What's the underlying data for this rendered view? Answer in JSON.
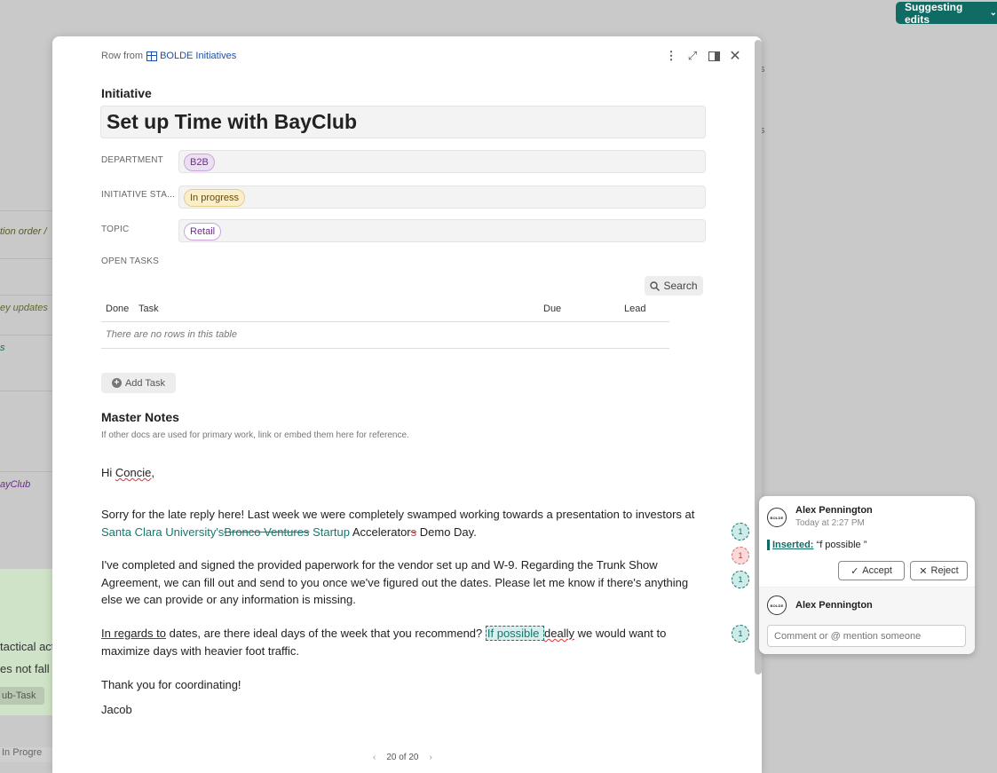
{
  "suggest_button": {
    "label": "Suggesting edits"
  },
  "background_left": {
    "rows": [
      "tion order /",
      "",
      "ey updates",
      "s",
      "",
      "ayClub"
    ],
    "green_lines": [
      "tactical act",
      "es not fall"
    ],
    "sub_task": "ub-Task",
    "bottom": "In Progre"
  },
  "background_right": {
    "r1": "s",
    "r2": "s"
  },
  "header": {
    "row_from": "Row from",
    "db_name": "BOLDE Initiatives"
  },
  "initiative": {
    "label": "Initiative",
    "title": "Set up Time with BayClub"
  },
  "properties": [
    {
      "label": "DEPARTMENT",
      "value": "B2B"
    },
    {
      "label": "INITIATIVE STA...",
      "value": "In progress"
    },
    {
      "label": "TOPIC",
      "value": "Retail"
    }
  ],
  "open_tasks": {
    "label": "OPEN TASKS",
    "search": "Search",
    "columns": [
      "Done",
      "Task",
      "Due",
      "Lead"
    ],
    "empty": "There are no rows in this table",
    "add_task": "Add Task"
  },
  "notes": {
    "title": "Master Notes",
    "subtitle": "If other docs are used for primary work, link or embed them here for reference.",
    "greeting_1": "Hi ",
    "greeting_name": "Concie",
    "greeting_2": ",",
    "p1_a": "Sorry for the late reply here! Last week we were completely swamped working towards a presentation to investors at ",
    "p1_ins1": "Santa Clara University's",
    "p1_del1": "Bronco Ventures",
    "p1_b": " ",
    "p1_ins2": "Startup",
    "p1_c": " Accelerator",
    "p1_del2": "s",
    "p1_d": " Demo Day.",
    "p2": "I've completed and signed the provided paperwork for the vendor set up and W-9. Regarding the Trunk Show Agreement, we can fill out and send to you once we've figured out the dates. Please let me know if there's anything else we can provide or any information is missing.",
    "p3_ul": "In regards to",
    "p3_a": " dates, are there ideal days of the week that you recommend? ",
    "p3_ins": "If possible ",
    "p3_sq": "deally",
    "p3_b": " we would want to maximize days with heavier foot traffic.",
    "p4": "Thank you for coordinating!",
    "sign": "Jacob"
  },
  "markers": [
    "1",
    "1",
    "1",
    "1"
  ],
  "pager": {
    "text": "20 of 20"
  },
  "comment": {
    "author": "Alex Pennington",
    "time": "Today at 2:27 PM",
    "avatar": "BOLDE",
    "inserted_label": "Inserted:",
    "inserted_text": " “f possible ”",
    "accept": "Accept",
    "reject": "Reject",
    "reply_author": "Alex Pennington",
    "placeholder": "Comment or @ mention someone"
  }
}
